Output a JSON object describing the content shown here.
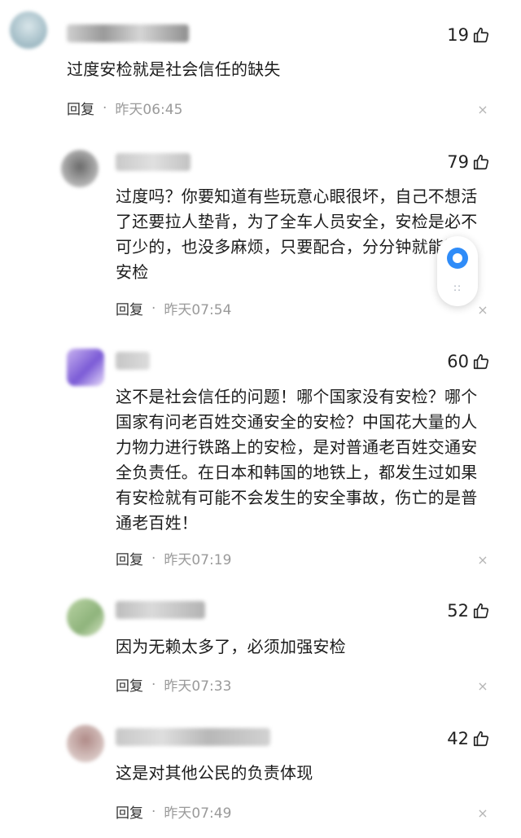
{
  "comments": [
    {
      "likes": "19",
      "text": "过度安检就是社会信任的缺失",
      "reply": "回复",
      "time": "昨天06:45"
    },
    {
      "likes": "79",
      "text_lines": [
        "过度吗？你要知道有些玩意心眼很坏，自己不想活",
        "了还要拉人垫背，为了全车人员安全，安检是必不",
        "可少的，也没多麻烦，只要配合，分分钟就能过",
        "安检"
      ],
      "reply": "回复",
      "time": "昨天07:54"
    },
    {
      "likes": "60",
      "text_lines": [
        "这不是社会信任的问题！哪个国家没有安检？哪个",
        "国家有问老百姓交通安全的安检？中国花大量的人",
        "力物力进行铁路上的安检，是对普通老百姓交通安",
        "全负责任。在日本和韩国的地铁上，都发生过如果",
        "有安检就有可能不会发生的安全事故，伤亡的是普",
        "通老百姓！"
      ],
      "reply": "回复",
      "time": "昨天07:19"
    },
    {
      "likes": "52",
      "text": "因为无赖太多了，必须加强安检",
      "reply": "回复",
      "time": "昨天07:33"
    },
    {
      "likes": "42",
      "text": "这是对其他公民的负责体现",
      "reply": "回复",
      "time": "昨天07:49"
    }
  ],
  "icons": {
    "like": "thumbs-up-icon",
    "close": "close-icon",
    "float": "chat-bubble-icon"
  },
  "colors": {
    "accent": "#2f8cf8",
    "time": "#9a9a9a",
    "close": "#b5b5b5"
  },
  "symbols": {
    "dot": "·",
    "close": "×",
    "grip": "::"
  }
}
